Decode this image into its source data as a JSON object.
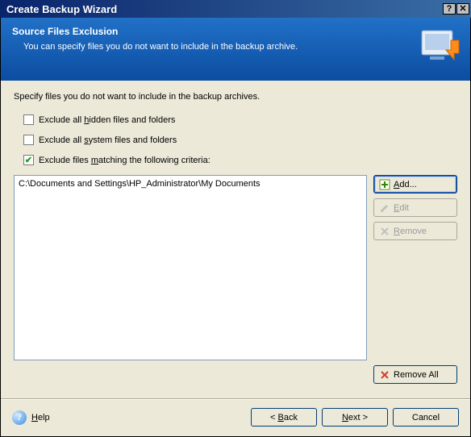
{
  "window": {
    "title": "Create Backup Wizard",
    "help_glyph": "?",
    "close_glyph": "✕"
  },
  "banner": {
    "title": "Source Files Exclusion",
    "subtitle": "You can specify files you do not want to include in the backup archive."
  },
  "content": {
    "instruction": "Specify files you do not want to include in the backup archives.",
    "checks": [
      {
        "label_pre": "Exclude all ",
        "mn": "h",
        "label_post": "idden files and folders",
        "checked": false
      },
      {
        "label_pre": "Exclude all ",
        "mn": "s",
        "label_post": "ystem files and folders",
        "checked": false
      },
      {
        "label_pre": "Exclude files ",
        "mn": "m",
        "label_post": "atching the following criteria:",
        "checked": true
      }
    ],
    "list_items": [
      "C:\\Documents and Settings\\HP_Administrator\\My Documents"
    ]
  },
  "buttons": {
    "add_mn": "A",
    "add_post": "dd...",
    "edit_mn": "E",
    "edit_post": "dit",
    "remove_mn": "R",
    "remove_post": "emove",
    "remove_all": "Remove All",
    "help_mn": "H",
    "help_post": "elp",
    "back_pre": "< ",
    "back_mn": "B",
    "back_post": "ack",
    "next_mn": "N",
    "next_post": "ext >",
    "cancel": "Cancel"
  }
}
